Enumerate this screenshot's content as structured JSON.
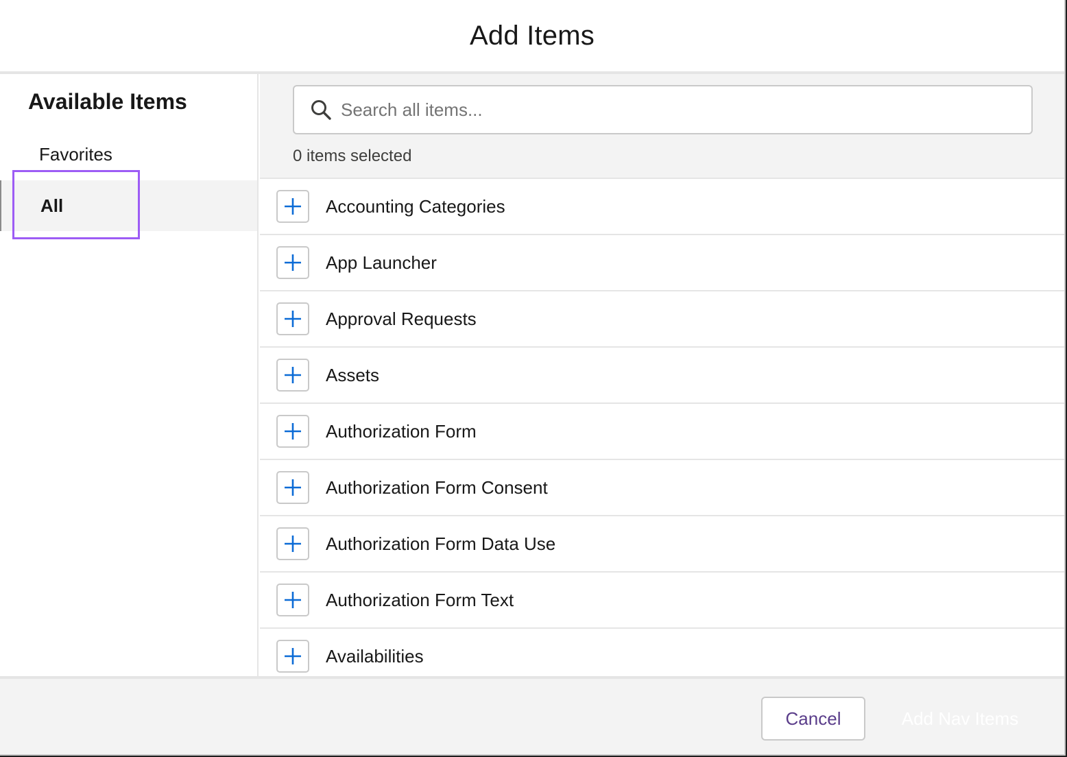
{
  "header": {
    "title": "Add Items"
  },
  "sidebar": {
    "title": "Available Items",
    "items": [
      {
        "label": "Favorites"
      },
      {
        "label": "All"
      }
    ]
  },
  "search": {
    "placeholder": "Search all items...",
    "value": ""
  },
  "selection": {
    "count_text": "0 items selected"
  },
  "list": {
    "items": [
      {
        "label": "Accounting Categories"
      },
      {
        "label": "App Launcher"
      },
      {
        "label": "Approval Requests"
      },
      {
        "label": "Assets"
      },
      {
        "label": "Authorization Form"
      },
      {
        "label": "Authorization Form Consent"
      },
      {
        "label": "Authorization Form Data Use"
      },
      {
        "label": "Authorization Form Text"
      },
      {
        "label": "Availabilities"
      }
    ]
  },
  "footer": {
    "cancel_label": "Cancel",
    "add_label": "Add Nav Items"
  },
  "colors": {
    "accent_plus": "#0b6bd6",
    "focus_ring": "#9d5cf5",
    "cancel_text": "#5a3d8a"
  },
  "icons": {
    "search": "search-icon",
    "add": "plus-icon"
  }
}
